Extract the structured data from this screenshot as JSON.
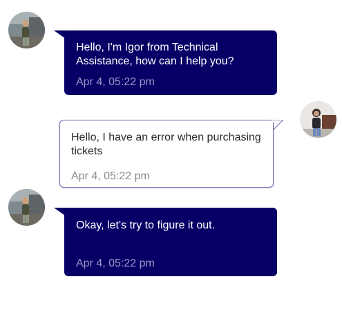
{
  "messages": [
    {
      "sender": "agent",
      "text": "Hello, I'm Igor from Technical Assistance, how can I help you?",
      "time": "Apr 4, 05:22 pm"
    },
    {
      "sender": "user",
      "text": "Hello, I have an error when purchasing tickets",
      "time": "Apr 4, 05:22 pm"
    },
    {
      "sender": "agent",
      "text": "Okay, let's try to figure it out.",
      "time": "Apr 4, 05:22 pm"
    }
  ],
  "colors": {
    "agent_bubble": "#060066",
    "agent_text": "#ffffff",
    "agent_time": "#9b97c8",
    "user_bubble": "#ffffff",
    "user_border": "#6b63b5",
    "user_time": "#8a8a8a"
  },
  "icons": {
    "agent_avatar": "avatar-agent-photo",
    "user_avatar": "avatar-user-photo"
  }
}
